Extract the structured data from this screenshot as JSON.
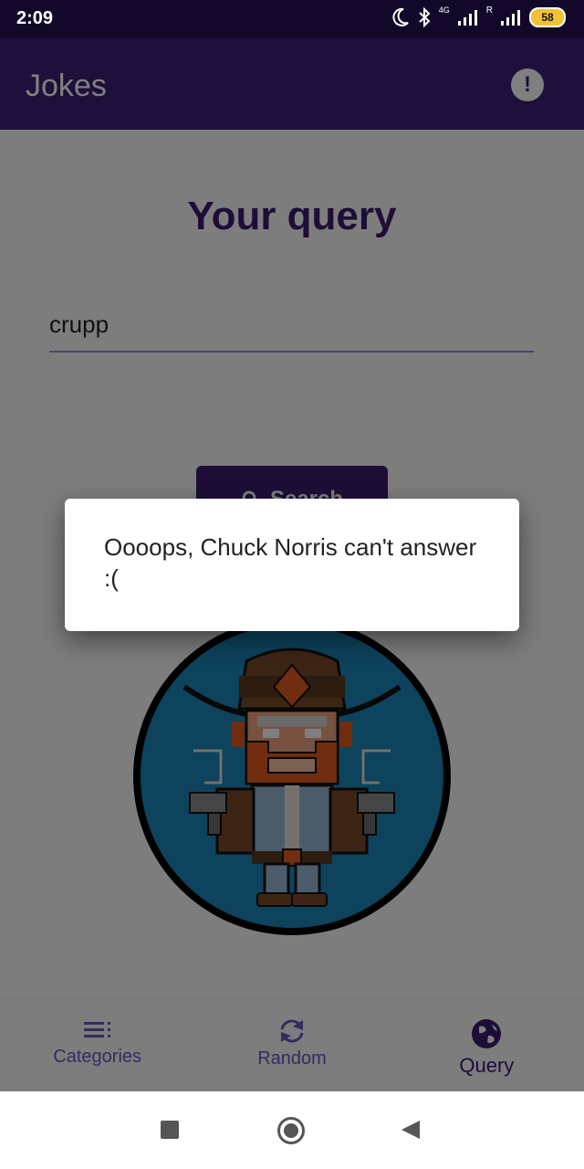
{
  "status_bar": {
    "time": "2:09",
    "network": "4G",
    "roaming": "R",
    "battery": "58"
  },
  "app_bar": {
    "title": "Jokes",
    "info_icon": "info-exclamation-icon"
  },
  "page": {
    "title": "Your query",
    "query_value": "crupp",
    "search_label": "Search"
  },
  "dialog": {
    "message": "Oooops, Chuck Norris can't answer :("
  },
  "bottom_nav": {
    "items": [
      {
        "label": "Categories",
        "icon": "list-icon"
      },
      {
        "label": "Random",
        "icon": "refresh-icon"
      },
      {
        "label": "Query",
        "icon": "globe-icon",
        "active": true
      }
    ]
  },
  "colors": {
    "primary": "#3e1f77",
    "primary_dark": "#13082a",
    "accent_text": "#3a1d6e",
    "inactive_nav": "#6a56c0"
  }
}
